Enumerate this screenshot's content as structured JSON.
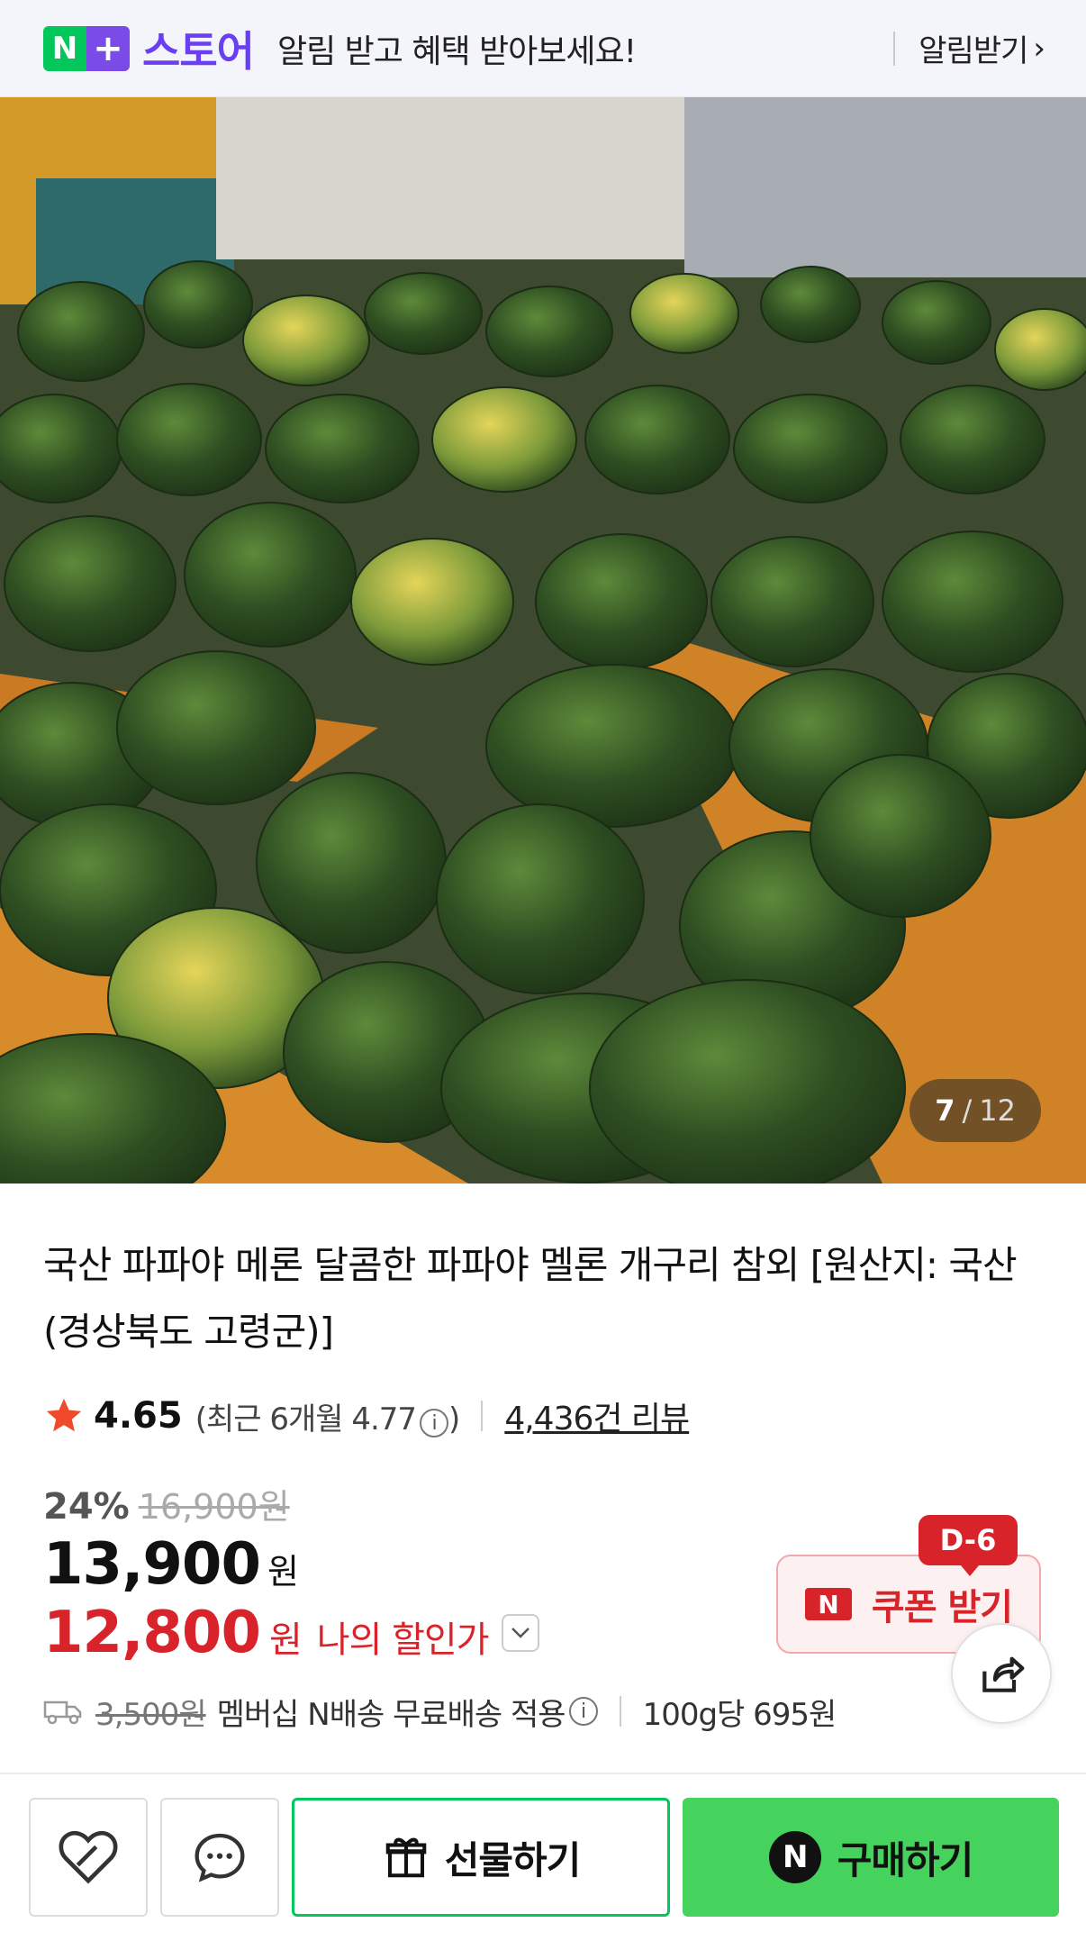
{
  "banner": {
    "logo_n": "N",
    "logo_plus": "+",
    "logo_text": "스토어",
    "message": "알림 받고 혜택 받아보세요!",
    "action": "알림받기",
    "action_icon": "chevron-right-icon"
  },
  "gallery": {
    "current": "7",
    "separator": "/",
    "total": "12"
  },
  "product": {
    "title": "국산 파파야 메론 달콤한 파파야 멜론 개구리 참외 [원산지: 국산(경상북도 고령군)]",
    "rating": "4.65",
    "recent_rating": "(최근 6개월 4.77",
    "recent_close": ")",
    "review_count": "4,436건 리뷰",
    "discount_pct": "24%",
    "original_price": "16,900원",
    "price": "13,900",
    "price_unit": "원",
    "my_price": "12,800",
    "my_price_unit": "원",
    "my_price_label": "나의 할인가",
    "shipping_fee": "3,500원",
    "shipping_text": "멤버십 N배송 무료배송 적용",
    "unit_price": "100g당 695원"
  },
  "coupon": {
    "badge": "D-6",
    "n_label": "N",
    "label": "쿠폰 받기"
  },
  "bottom_bar": {
    "gift_label": "선물하기",
    "buy_n": "N",
    "buy_label": "구매하기"
  },
  "colors": {
    "naver_green": "#03c75a",
    "store_purple": "#6a3ff2",
    "discount_red": "#d8232a",
    "buy_button": "#46d35d"
  }
}
